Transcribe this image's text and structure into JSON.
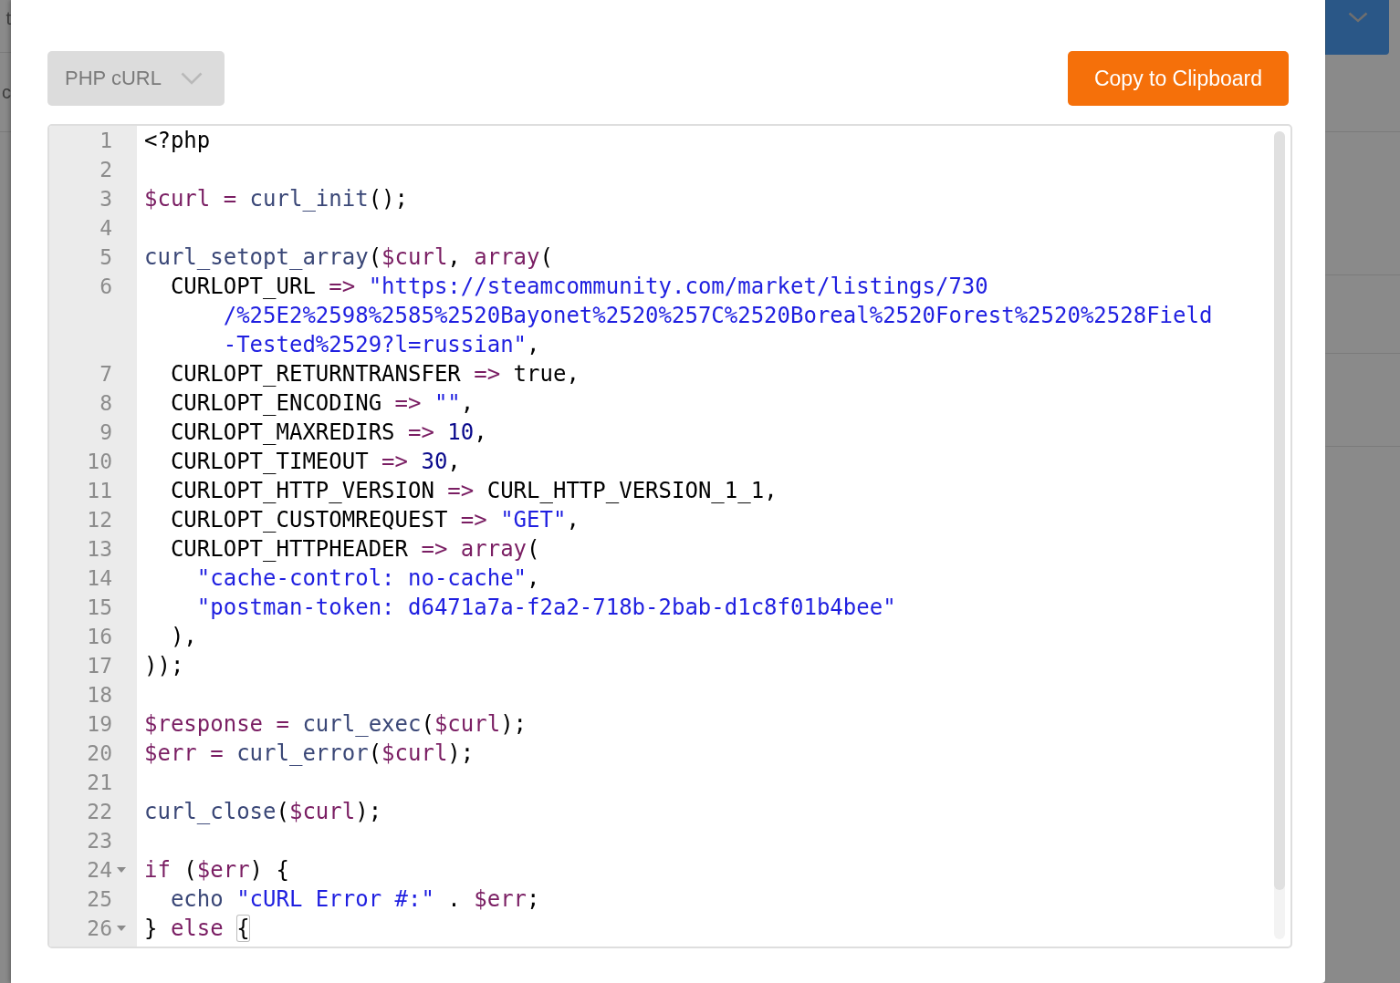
{
  "backdrop": {
    "fragments": [
      "t",
      "c"
    ]
  },
  "dialog": {
    "language_select": {
      "value": "PHP cURL"
    },
    "copy_button": {
      "label": "Copy to Clipboard"
    },
    "editor": {
      "lines": [
        {
          "number": "1",
          "foldable": false,
          "tokens": [
            {
              "kind": "plain",
              "text": "<?php"
            }
          ]
        },
        {
          "number": "2",
          "foldable": false
        },
        {
          "number": "3",
          "foldable": false,
          "tokens": [
            {
              "kind": "variable",
              "text": "$curl"
            },
            {
              "kind": "operator",
              "text": " = "
            },
            {
              "kind": "function",
              "text": "curl_init"
            },
            {
              "kind": "plain",
              "text": "();"
            }
          ]
        },
        {
          "number": "4",
          "foldable": false
        },
        {
          "number": "5",
          "foldable": false,
          "tokens": [
            {
              "kind": "function",
              "text": "curl_setopt_array"
            },
            {
              "kind": "plain",
              "text": "("
            },
            {
              "kind": "variable",
              "text": "$curl"
            },
            {
              "kind": "plain",
              "text": ", "
            },
            {
              "kind": "keyword",
              "text": "array"
            },
            {
              "kind": "plain",
              "text": "("
            }
          ]
        },
        {
          "number": "6",
          "foldable": false,
          "tokens": [
            {
              "kind": "plain",
              "text": "  CURLOPT_URL "
            },
            {
              "kind": "operator",
              "text": "=> "
            },
            {
              "kind": "string",
              "text": "\"https://steamcommunity.com/market/listings/730"
            }
          ],
          "wrapped": [
            {
              "tokens": [
                {
                  "kind": "string",
                  "text": "/%25E2%2598%2585%2520Bayonet%2520%257C%2520Boreal%2520Forest%2520%2528Field"
                }
              ]
            },
            {
              "tokens": [
                {
                  "kind": "string",
                  "text": "-Tested%2529?l=russian\""
                },
                {
                  "kind": "plain",
                  "text": ","
                }
              ]
            }
          ]
        },
        {
          "number": "7",
          "foldable": false,
          "tokens": [
            {
              "kind": "plain",
              "text": "  CURLOPT_RETURNTRANSFER "
            },
            {
              "kind": "operator",
              "text": "=>"
            },
            {
              "kind": "plain",
              "text": " true,"
            }
          ]
        },
        {
          "number": "8",
          "foldable": false,
          "tokens": [
            {
              "kind": "plain",
              "text": "  CURLOPT_ENCODING "
            },
            {
              "kind": "operator",
              "text": "=> "
            },
            {
              "kind": "string",
              "text": "\"\""
            },
            {
              "kind": "plain",
              "text": ","
            }
          ]
        },
        {
          "number": "9",
          "foldable": false,
          "tokens": [
            {
              "kind": "plain",
              "text": "  CURLOPT_MAXREDIRS "
            },
            {
              "kind": "operator",
              "text": "=> "
            },
            {
              "kind": "number",
              "text": "10"
            },
            {
              "kind": "plain",
              "text": ","
            }
          ]
        },
        {
          "number": "10",
          "foldable": false,
          "tokens": [
            {
              "kind": "plain",
              "text": "  CURLOPT_TIMEOUT "
            },
            {
              "kind": "operator",
              "text": "=> "
            },
            {
              "kind": "number",
              "text": "30"
            },
            {
              "kind": "plain",
              "text": ","
            }
          ]
        },
        {
          "number": "11",
          "foldable": false,
          "tokens": [
            {
              "kind": "plain",
              "text": "  CURLOPT_HTTP_VERSION "
            },
            {
              "kind": "operator",
              "text": "=>"
            },
            {
              "kind": "plain",
              "text": " CURL_HTTP_VERSION_1_1,"
            }
          ]
        },
        {
          "number": "12",
          "foldable": false,
          "tokens": [
            {
              "kind": "plain",
              "text": "  CURLOPT_CUSTOMREQUEST "
            },
            {
              "kind": "operator",
              "text": "=> "
            },
            {
              "kind": "string",
              "text": "\"GET\""
            },
            {
              "kind": "plain",
              "text": ","
            }
          ]
        },
        {
          "number": "13",
          "foldable": false,
          "tokens": [
            {
              "kind": "plain",
              "text": "  CURLOPT_HTTPHEADER "
            },
            {
              "kind": "operator",
              "text": "=> "
            },
            {
              "kind": "keyword",
              "text": "array"
            },
            {
              "kind": "plain",
              "text": "("
            }
          ]
        },
        {
          "number": "14",
          "foldable": false,
          "tokens": [
            {
              "kind": "string",
              "text": "    \"cache-control: no-cache\""
            },
            {
              "kind": "plain",
              "text": ","
            }
          ]
        },
        {
          "number": "15",
          "foldable": false,
          "tokens": [
            {
              "kind": "string",
              "text": "    \"postman-token: d6471a7a-f2a2-718b-2bab-d1c8f01b4bee\""
            }
          ]
        },
        {
          "number": "16",
          "foldable": false,
          "tokens": [
            {
              "kind": "plain",
              "text": "  ),"
            }
          ]
        },
        {
          "number": "17",
          "foldable": false,
          "tokens": [
            {
              "kind": "plain",
              "text": "));"
            }
          ]
        },
        {
          "number": "18",
          "foldable": false
        },
        {
          "number": "19",
          "foldable": false,
          "tokens": [
            {
              "kind": "variable",
              "text": "$response"
            },
            {
              "kind": "operator",
              "text": " = "
            },
            {
              "kind": "function",
              "text": "curl_exec"
            },
            {
              "kind": "plain",
              "text": "("
            },
            {
              "kind": "variable",
              "text": "$curl"
            },
            {
              "kind": "plain",
              "text": ");"
            }
          ]
        },
        {
          "number": "20",
          "foldable": false,
          "tokens": [
            {
              "kind": "variable",
              "text": "$err"
            },
            {
              "kind": "operator",
              "text": " = "
            },
            {
              "kind": "function",
              "text": "curl_error"
            },
            {
              "kind": "plain",
              "text": "("
            },
            {
              "kind": "variable",
              "text": "$curl"
            },
            {
              "kind": "plain",
              "text": ");"
            }
          ]
        },
        {
          "number": "21",
          "foldable": false
        },
        {
          "number": "22",
          "foldable": false,
          "tokens": [
            {
              "kind": "function",
              "text": "curl_close"
            },
            {
              "kind": "plain",
              "text": "("
            },
            {
              "kind": "variable",
              "text": "$curl"
            },
            {
              "kind": "plain",
              "text": ");"
            }
          ]
        },
        {
          "number": "23",
          "foldable": false
        },
        {
          "number": "24",
          "foldable": true,
          "tokens": [
            {
              "kind": "keyword",
              "text": "if"
            },
            {
              "kind": "plain",
              "text": " ("
            },
            {
              "kind": "variable",
              "text": "$err"
            },
            {
              "kind": "plain",
              "text": ") {"
            }
          ]
        },
        {
          "number": "25",
          "foldable": false,
          "tokens": [
            {
              "kind": "function",
              "text": "  echo "
            },
            {
              "kind": "string",
              "text": "\"cURL Error #:\""
            },
            {
              "kind": "plain",
              "text": " . "
            },
            {
              "kind": "variable",
              "text": "$err"
            },
            {
              "kind": "plain",
              "text": ";"
            }
          ]
        },
        {
          "number": "26",
          "foldable": true,
          "tokens": [
            {
              "kind": "plain",
              "text": "} "
            },
            {
              "kind": "keyword",
              "text": "else "
            },
            {
              "kind": "bracket",
              "text": "{"
            }
          ]
        }
      ]
    }
  }
}
